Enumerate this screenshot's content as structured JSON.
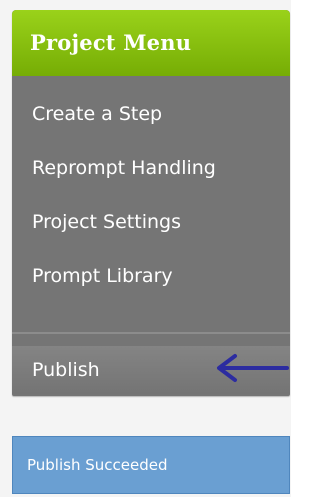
{
  "menu": {
    "title": "Project Menu",
    "items": [
      {
        "label": "Create a Step"
      },
      {
        "label": "Reprompt Handling"
      },
      {
        "label": "Project Settings"
      },
      {
        "label": "Prompt Library"
      }
    ],
    "publish_label": "Publish"
  },
  "status": {
    "message": "Publish Succeeded"
  },
  "colors": {
    "header_green": "#8cc414",
    "menu_gray": "#757575",
    "status_blue": "#6a9fd2",
    "arrow_blue": "#2c2ca0"
  },
  "icons": {
    "pointer_arrow": "arrow-left-icon"
  }
}
